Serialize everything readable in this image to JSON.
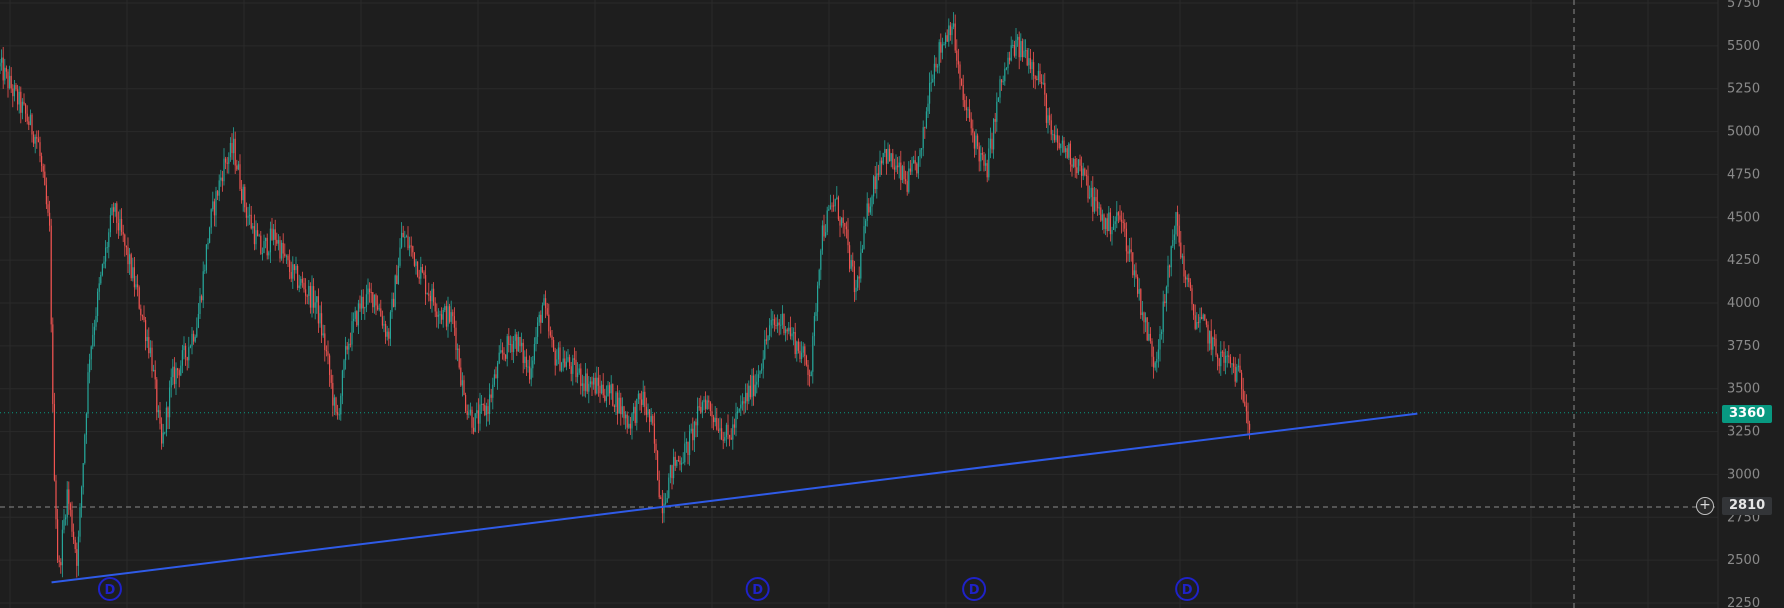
{
  "colors": {
    "background": "#1e1e1e",
    "grid": "#2a2a2a",
    "up_candle": "#26a69a",
    "down_candle": "#ef5350",
    "trendline": "#2f5be8",
    "last_price_bg": "#089981",
    "event_marker": "#1f22c8",
    "axis_text": "#8a8a8a",
    "crosshair": "#8a8a8a"
  },
  "price_axis": {
    "ticks": [
      "5750",
      "5500",
      "5250",
      "5000",
      "4750",
      "4500",
      "4250",
      "4000",
      "3750",
      "3500",
      "3250",
      "3000",
      "2750",
      "2500",
      "2250"
    ]
  },
  "last_price": {
    "label": "3360",
    "value": 3360
  },
  "crosshair": {
    "price_label": "2810",
    "price_value": 2810,
    "plus_icon": "plus-circle-icon"
  },
  "trendline": {
    "points": [
      {
        "bar": 0.03,
        "price": 2370
      },
      {
        "bar": 0.825,
        "price": 3355
      }
    ]
  },
  "event_markers": [
    {
      "label": "D",
      "bar_fraction": 0.064
    },
    {
      "label": "D",
      "bar_fraction": 0.441
    },
    {
      "label": "D",
      "bar_fraction": 0.567
    },
    {
      "label": "D",
      "bar_fraction": 0.691
    }
  ],
  "chart_data": {
    "type": "candlestick",
    "ylim": [
      2250,
      5750
    ],
    "price_path": [
      [
        0.0,
        5380
      ],
      [
        0.012,
        5150
      ],
      [
        0.022,
        4950
      ],
      [
        0.029,
        4400
      ],
      [
        0.031,
        3200
      ],
      [
        0.034,
        2400
      ],
      [
        0.039,
        2900
      ],
      [
        0.045,
        2500
      ],
      [
        0.052,
        3700
      ],
      [
        0.058,
        4100
      ],
      [
        0.066,
        4550
      ],
      [
        0.072,
        4350
      ],
      [
        0.08,
        4050
      ],
      [
        0.088,
        3700
      ],
      [
        0.094,
        3150
      ],
      [
        0.1,
        3550
      ],
      [
        0.108,
        3700
      ],
      [
        0.115,
        3900
      ],
      [
        0.122,
        4450
      ],
      [
        0.13,
        4800
      ],
      [
        0.136,
        4900
      ],
      [
        0.143,
        4550
      ],
      [
        0.152,
        4300
      ],
      [
        0.16,
        4400
      ],
      [
        0.168,
        4200
      ],
      [
        0.176,
        4100
      ],
      [
        0.184,
        4000
      ],
      [
        0.19,
        3700
      ],
      [
        0.196,
        3300
      ],
      [
        0.202,
        3750
      ],
      [
        0.21,
        4000
      ],
      [
        0.218,
        4050
      ],
      [
        0.226,
        3800
      ],
      [
        0.234,
        4400
      ],
      [
        0.24,
        4300
      ],
      [
        0.248,
        4100
      ],
      [
        0.256,
        3950
      ],
      [
        0.264,
        3900
      ],
      [
        0.27,
        3450
      ],
      [
        0.276,
        3300
      ],
      [
        0.284,
        3400
      ],
      [
        0.292,
        3700
      ],
      [
        0.3,
        3800
      ],
      [
        0.308,
        3600
      ],
      [
        0.316,
        4000
      ],
      [
        0.322,
        3700
      ],
      [
        0.33,
        3650
      ],
      [
        0.34,
        3550
      ],
      [
        0.35,
        3500
      ],
      [
        0.358,
        3450
      ],
      [
        0.366,
        3300
      ],
      [
        0.374,
        3450
      ],
      [
        0.38,
        3250
      ],
      [
        0.385,
        2820
      ],
      [
        0.392,
        3050
      ],
      [
        0.4,
        3150
      ],
      [
        0.41,
        3450
      ],
      [
        0.418,
        3300
      ],
      [
        0.424,
        3200
      ],
      [
        0.432,
        3400
      ],
      [
        0.44,
        3550
      ],
      [
        0.448,
        3850
      ],
      [
        0.456,
        3900
      ],
      [
        0.464,
        3750
      ],
      [
        0.472,
        3600
      ],
      [
        0.478,
        4400
      ],
      [
        0.486,
        4600
      ],
      [
        0.492,
        4400
      ],
      [
        0.498,
        4050
      ],
      [
        0.506,
        4600
      ],
      [
        0.514,
        4900
      ],
      [
        0.52,
        4800
      ],
      [
        0.528,
        4700
      ],
      [
        0.536,
        4850
      ],
      [
        0.542,
        5350
      ],
      [
        0.548,
        5500
      ],
      [
        0.554,
        5650
      ],
      [
        0.56,
        5200
      ],
      [
        0.566,
        5000
      ],
      [
        0.574,
        4750
      ],
      [
        0.582,
        5250
      ],
      [
        0.59,
        5500
      ],
      [
        0.598,
        5450
      ],
      [
        0.606,
        5300
      ],
      [
        0.612,
        4950
      ],
      [
        0.62,
        4900
      ],
      [
        0.628,
        4800
      ],
      [
        0.636,
        4600
      ],
      [
        0.644,
        4450
      ],
      [
        0.652,
        4500
      ],
      [
        0.66,
        4200
      ],
      [
        0.666,
        3900
      ],
      [
        0.672,
        3650
      ],
      [
        0.678,
        4000
      ],
      [
        0.684,
        4500
      ],
      [
        0.69,
        4150
      ],
      [
        0.696,
        3900
      ],
      [
        0.702,
        3850
      ],
      [
        0.708,
        3700
      ],
      [
        0.716,
        3650
      ],
      [
        0.722,
        3550
      ],
      [
        0.726,
        3400
      ],
      [
        0.728,
        3230
      ]
    ]
  }
}
